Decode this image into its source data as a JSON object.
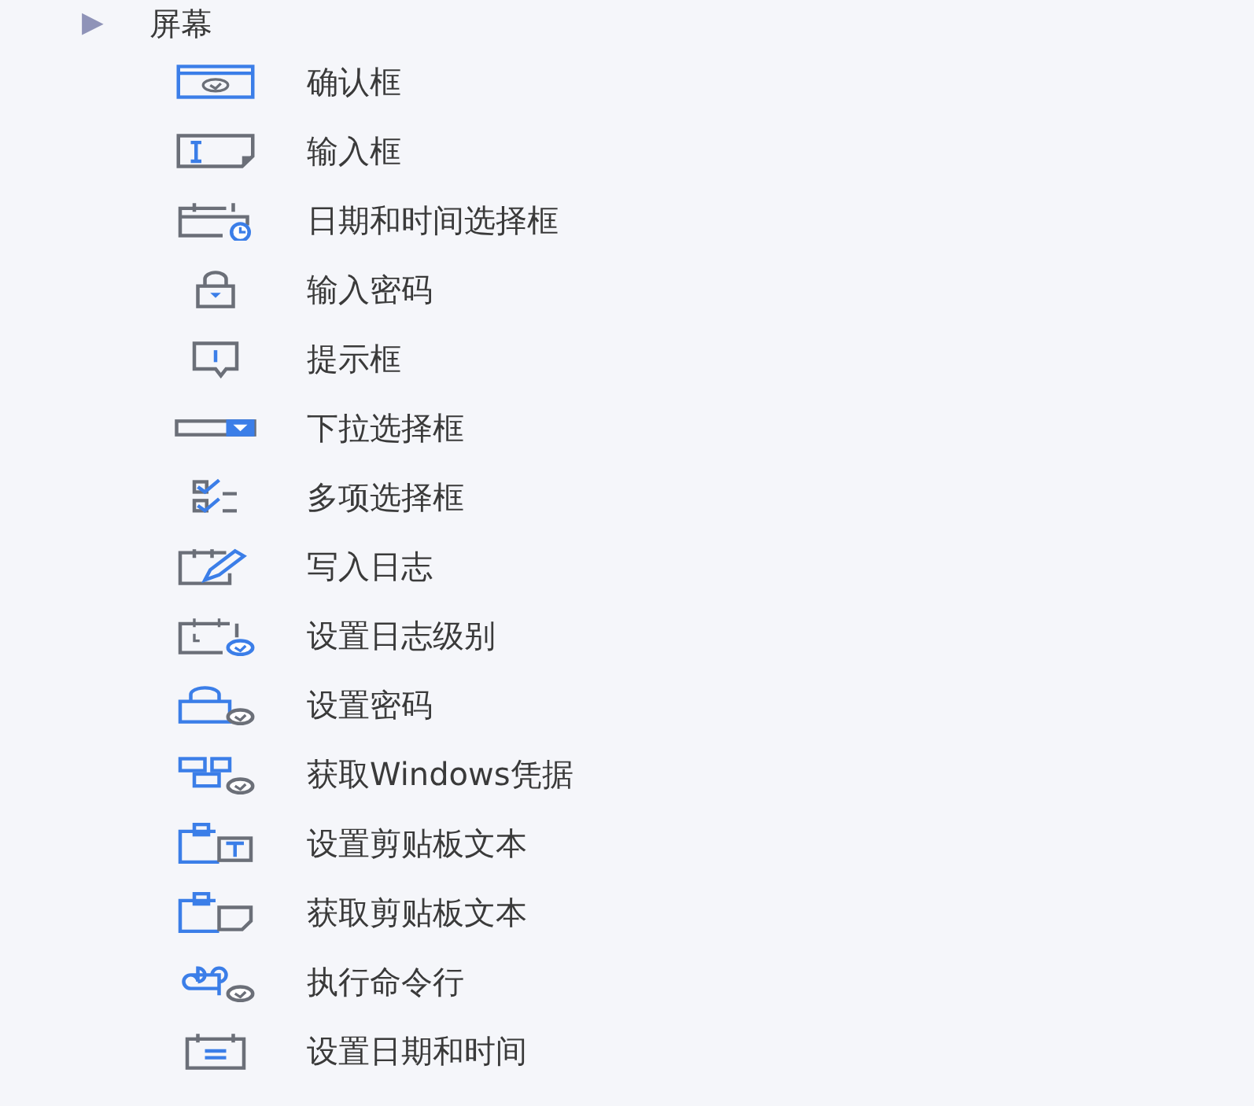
{
  "tree": {
    "label": "屏幕",
    "toggle": "▶",
    "children": [
      {
        "label": "确认框"
      },
      {
        "label": "输入框"
      },
      {
        "label": "日期和时间选择框"
      },
      {
        "label": "输入密码"
      },
      {
        "label": "提示框"
      },
      {
        "label": "下拉选择框"
      },
      {
        "label": "多项选择框"
      },
      {
        "label": "写入日志"
      },
      {
        "label": "设置日志级别"
      },
      {
        "label": "设置密码"
      },
      {
        "label": "获取Windows凭据"
      },
      {
        "label": "设置剪贴板文本"
      },
      {
        "label": "获取剪贴板文本"
      },
      {
        "label": "执行命令行"
      },
      {
        "label": "设置日期和时间"
      }
    ]
  }
}
